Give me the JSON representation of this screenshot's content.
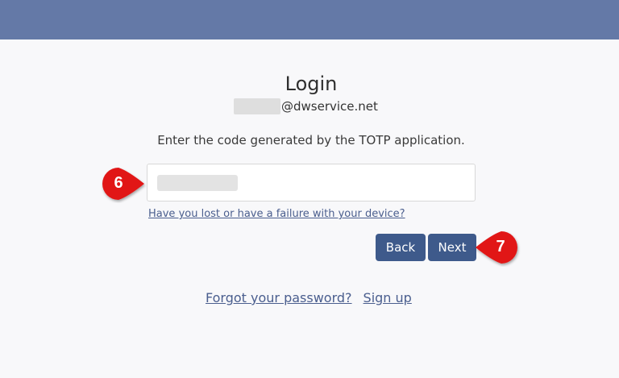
{
  "header": {
    "bar_color": "#6479a7"
  },
  "login": {
    "title": "Login",
    "account_domain": "@dwservice.net",
    "instruction": "Enter the code generated by the TOTP application.",
    "lost_device_link": "Have you lost or have a failure with your device?",
    "back_label": "Back",
    "next_label": "Next",
    "forgot_password_link": "Forgot your password?",
    "sign_up_link": "Sign up"
  },
  "annotations": {
    "step_input": "6",
    "step_next": "7",
    "callout_color": "#e11818"
  }
}
